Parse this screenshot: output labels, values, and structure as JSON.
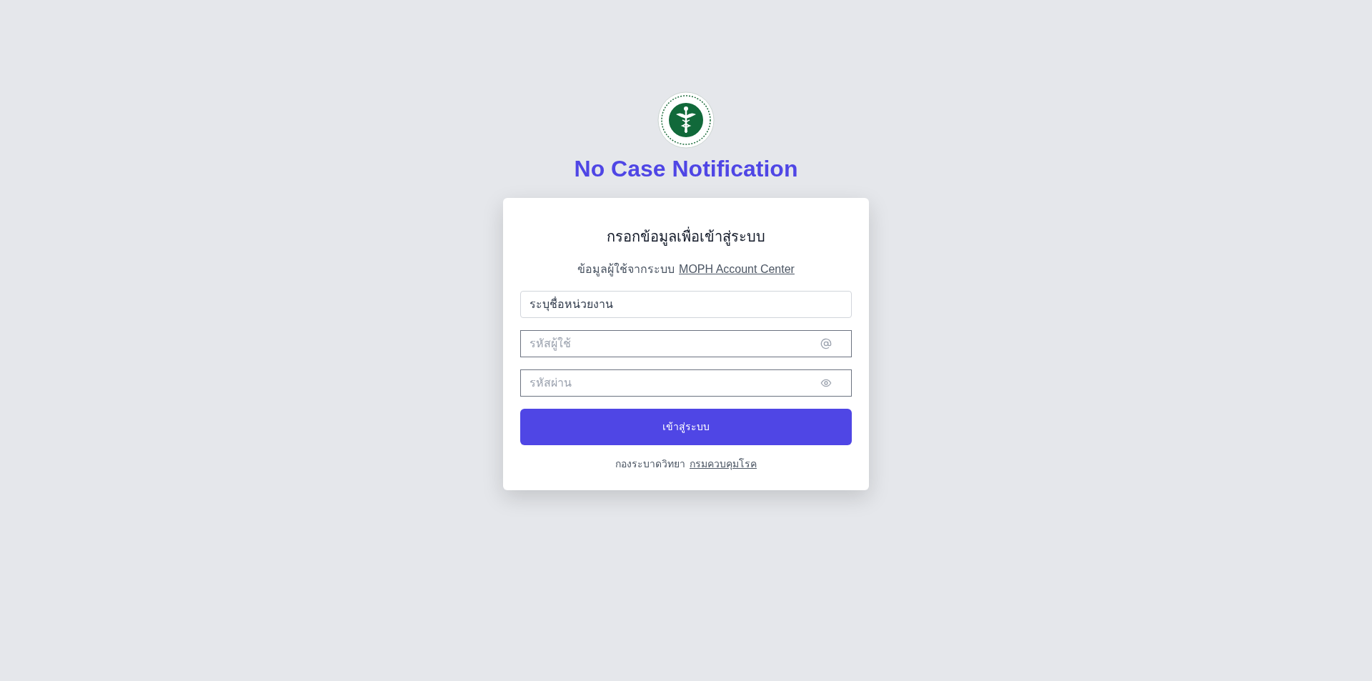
{
  "app_title": "No Case Notification",
  "card": {
    "heading": "กรอกข้อมูลเพื่อเข้าสู่ระบบ",
    "source_text": "ข้อมูลผู้ใช้จากระบบ",
    "source_link": "MOPH Account Center",
    "fields": [
      {
        "kind": "select",
        "placeholder": "ระบุชื่อหน่วยงาน"
      },
      {
        "kind": "email",
        "placeholder": "รหัสผู้ใช้"
      },
      {
        "kind": "password",
        "placeholder": "รหัสผ่าน"
      }
    ],
    "submit": "เข้าสู่ระบบ",
    "footer_text": "กองระบาดวิทยา",
    "footer_link": "กรมควบคุมโรค"
  }
}
